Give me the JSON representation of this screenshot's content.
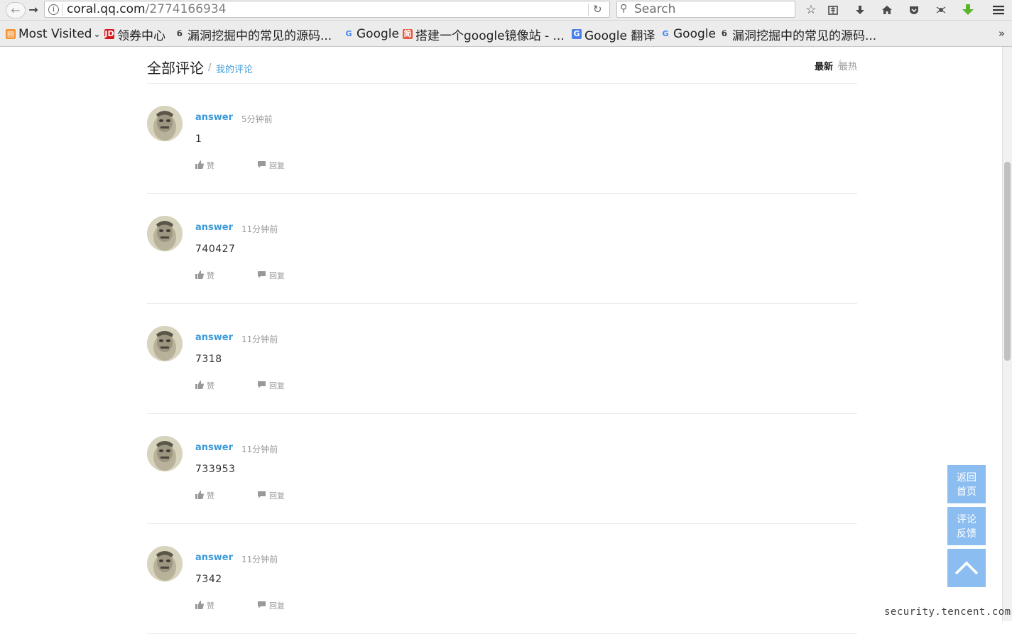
{
  "browser": {
    "url_host": "coral.qq.com",
    "url_path": "/2774166934",
    "search_placeholder": "Search"
  },
  "bookmarks": [
    {
      "label": "Most Visited",
      "icon": "most-visited-icon"
    },
    {
      "label": "领券中心",
      "icon": "jd-icon"
    },
    {
      "label": "漏洞挖掘中的常见的源码...",
      "icon": "bug-icon"
    },
    {
      "label": "Google",
      "icon": "google-icon"
    },
    {
      "label": "搭建一个google镜像站 - ...",
      "icon": "jianshu-icon"
    },
    {
      "label": "Google 翻译",
      "icon": "google-translate-icon"
    },
    {
      "label": "Google",
      "icon": "google-icon"
    },
    {
      "label": "漏洞挖掘中的常见的源码...",
      "icon": "bug-icon"
    }
  ],
  "header": {
    "tab_all": "全部评论",
    "separator": "/",
    "tab_mine": "我的评论",
    "sort_new": "最新",
    "sort_hot": "最热"
  },
  "comments": [
    {
      "user": "answer",
      "time": "5分钟前",
      "content": "1",
      "like_label": "赞",
      "reply_label": "回复"
    },
    {
      "user": "answer",
      "time": "11分钟前",
      "content": "740427",
      "like_label": "赞",
      "reply_label": "回复"
    },
    {
      "user": "answer",
      "time": "11分钟前",
      "content": "7318",
      "like_label": "赞",
      "reply_label": "回复"
    },
    {
      "user": "answer",
      "time": "11分钟前",
      "content": "733953",
      "like_label": "赞",
      "reply_label": "回复"
    },
    {
      "user": "answer",
      "time": "11分钟前",
      "content": "7342",
      "like_label": "赞",
      "reply_label": "回复"
    }
  ],
  "side_buttons": {
    "home_line1": "返回",
    "home_line2": "首页",
    "feedback_line1": "评论",
    "feedback_line2": "反馈"
  },
  "watermark": "security.tencent.com",
  "colors": {
    "link": "#3e9ad8",
    "side_button": "#8cbdf0"
  }
}
